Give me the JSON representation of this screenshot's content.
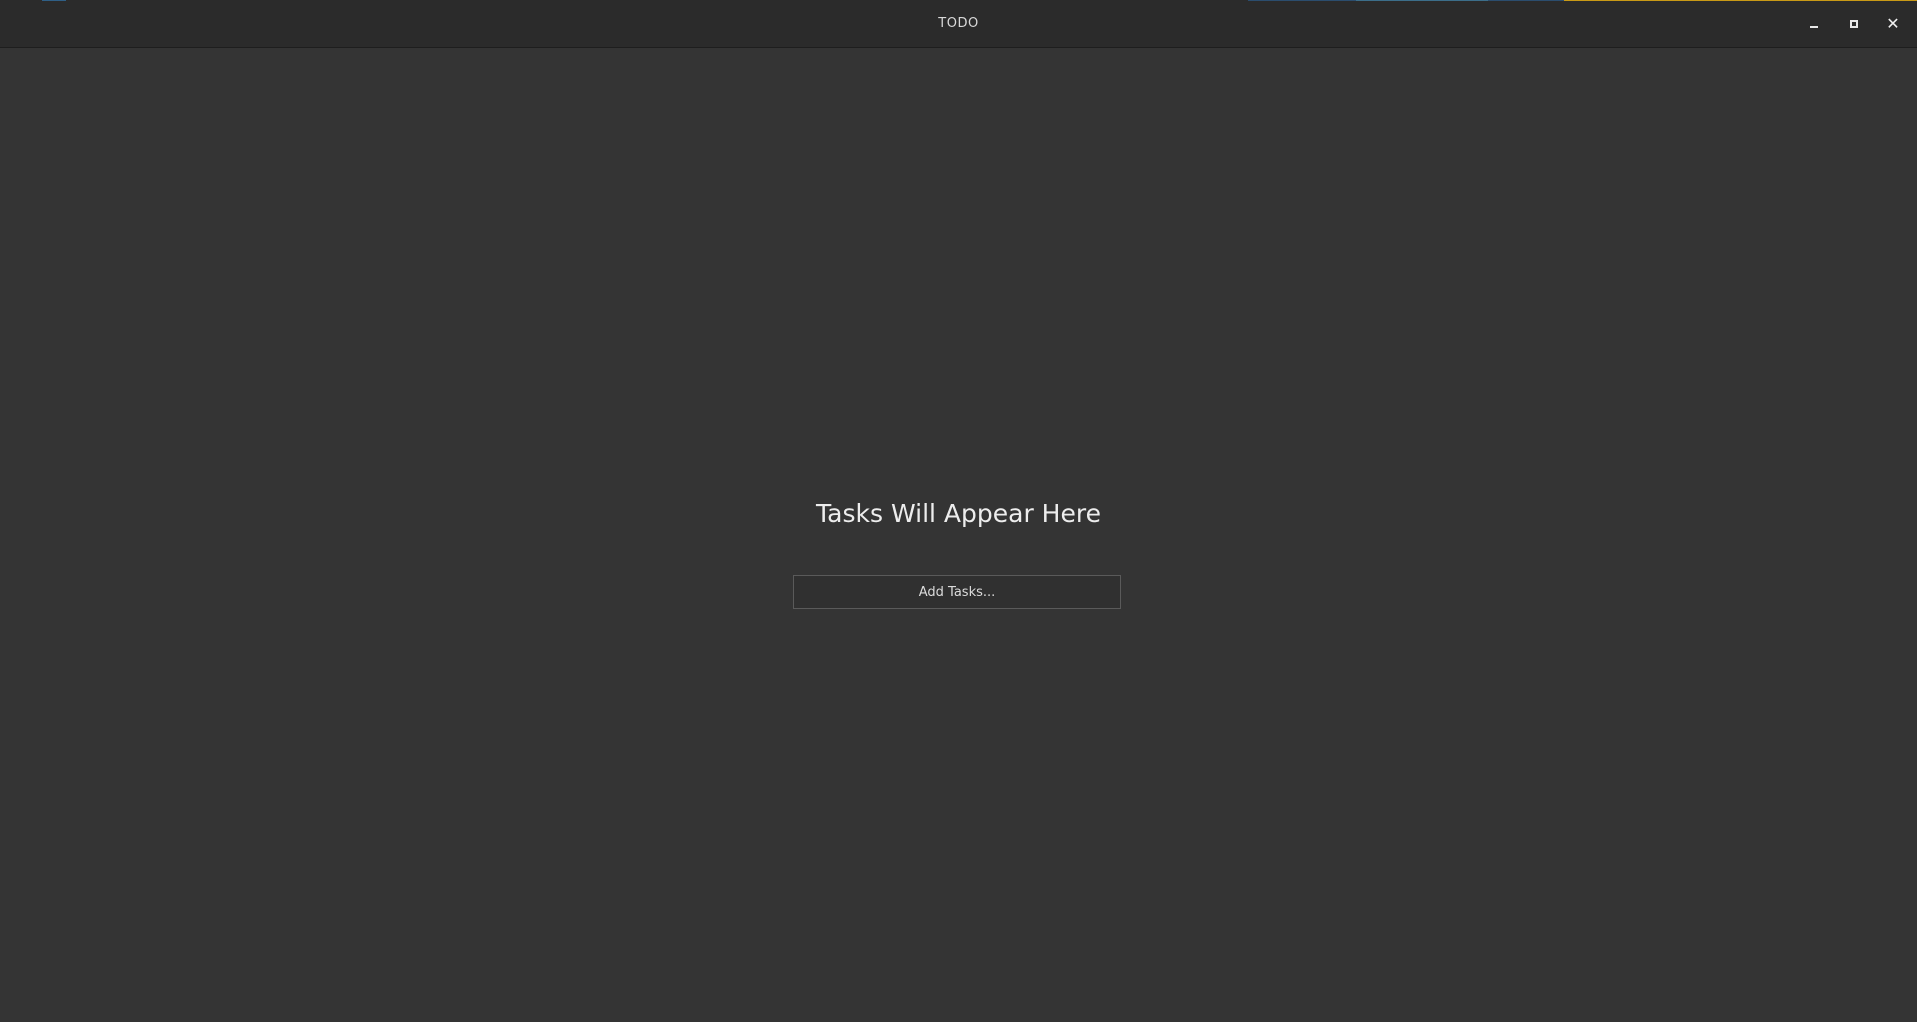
{
  "window": {
    "title": "TODO"
  },
  "titlebar_controls": {
    "minimize_icon": "minimize-icon",
    "maximize_icon": "maximize-icon",
    "close_icon": "close-icon",
    "close_glyph": "✕"
  },
  "main": {
    "empty_state_title": "Tasks Will Appear Here",
    "add_button_label": "Add Tasks..."
  },
  "colors": {
    "background": "#343434",
    "titlebar": "#2b2b2b",
    "accent_strip_blue": "#2b5f8a",
    "accent_strip_yellow": "#d4a017"
  }
}
